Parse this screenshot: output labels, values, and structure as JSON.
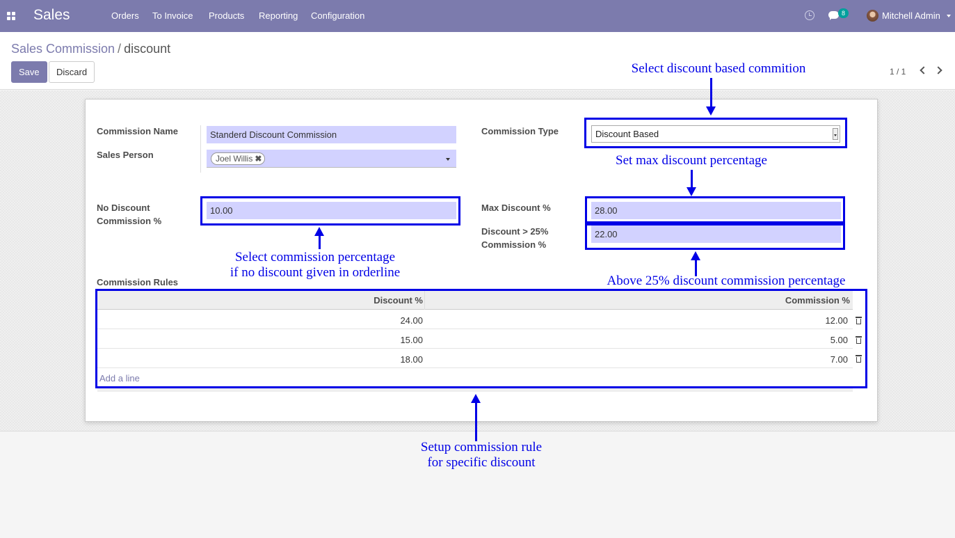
{
  "navbar": {
    "app_name": "Sales",
    "menu": [
      "Orders",
      "To Invoice",
      "Products",
      "Reporting",
      "Configuration"
    ],
    "chat_count": "8",
    "user_name": "Mitchell Admin"
  },
  "breadcrumb": {
    "parent": "Sales Commission",
    "separator": "/",
    "current": "discount"
  },
  "buttons": {
    "save": "Save",
    "discard": "Discard"
  },
  "pager": {
    "text": "1 / 1"
  },
  "form": {
    "commission_name_label": "Commission Name",
    "commission_name_value": "Standerd Discount Commission",
    "sales_person_label": "Sales Person",
    "sales_person_tag": "Joel Willis",
    "commission_type_label": "Commission Type",
    "commission_type_value": "Discount Based",
    "no_discount_label_1": "No Discount",
    "no_discount_label_2": "Commission %",
    "no_discount_value": "10.00",
    "max_discount_label": "Max Discount %",
    "max_discount_value": "28.00",
    "above_discount_label_1": "Discount > 25%",
    "above_discount_label_2": "Commission %",
    "above_discount_value": "22.00",
    "rules_label": "Commission Rules"
  },
  "rules_table": {
    "headers": [
      "Discount %",
      "Commission %"
    ],
    "rows": [
      [
        "24.00",
        "12.00"
      ],
      [
        "15.00",
        "5.00"
      ],
      [
        "18.00",
        "7.00"
      ]
    ],
    "add_line": "Add a line"
  },
  "annotations": {
    "commission_type": "Select discount based commition",
    "max_discount": "Set max discount percentage",
    "no_discount_1": "Select commission percentage",
    "no_discount_2": "if no discount given in orderline",
    "above_discount": "Above 25% discount commission percentage",
    "rules_1": "Setup commission rule",
    "rules_2": "for specific discount",
    "color": "#0000e6"
  },
  "colors": {
    "navbar": "#7c7bad",
    "field": "#d2d2ff",
    "accent": "#7c7bad"
  }
}
